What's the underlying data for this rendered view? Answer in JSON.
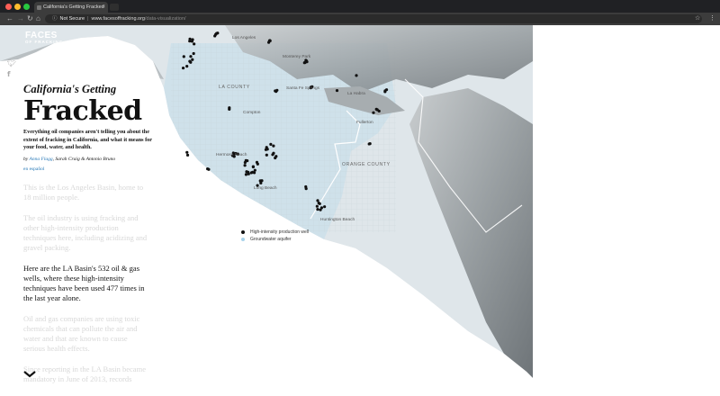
{
  "browser": {
    "tab_title": "California's Getting Fracked",
    "tab_close": "×",
    "info_icon": "info-icon",
    "not_secure": "Not Secure",
    "separator": "|",
    "url_host": "www.facesoffracking.org",
    "url_path": "/data-visualization/",
    "colors": {
      "titlebar": "#202124",
      "toolbar": "#3c3c3c"
    }
  },
  "brand": {
    "line1": "FACES",
    "line2": "OF FRACKING"
  },
  "social": {
    "twitter": "twitter-icon",
    "facebook": "facebook-icon"
  },
  "story": {
    "kicker": "California's Getting",
    "headline": "Fracked",
    "dek": "Everything oil companies aren't telling you about the extent of fracking in California, and what it means for your food, water, and health.",
    "byline_prefix": "by",
    "author1": "Anna Flagg",
    "byline_sep": ",",
    "author2_rest": "Sarah Craig & Antonio Bruno",
    "language": "en español",
    "paragraphs": [
      {
        "text": "This is the Los Angeles Basin, home to 18 million people.",
        "active": false
      },
      {
        "text": "The oil industry is using fracking and other high-intensity production techniques here, including acidizing and gravel packing.",
        "active": false
      },
      {
        "text": "Here are the LA Basin's 532 oil & gas wells, where these high-intensity techniques have been used 477 times in the last year alone.",
        "active": true
      },
      {
        "text": "Oil and gas companies are using toxic chemicals that can pollute the air and water and that are known to cause serious health effects.",
        "active": false
      },
      {
        "text": "Since reporting in the LA Basin became mandatory in June of 2013, records",
        "active": false
      }
    ]
  },
  "map": {
    "labels": {
      "los_angeles": "Los Angeles",
      "monterey_park": "Monterey Park",
      "la_county": "LA COUNTY",
      "santa_fe_springs": "Santa Fe Springs",
      "la_habra": "La Habra",
      "compton": "Compton",
      "fullerton": "Fullerton",
      "long_beach": "Long Beach",
      "orange_county": "ORANGE COUNTY",
      "huntington_beach": "Huntington Beach",
      "hermosa_beach": "Hermosa Beach"
    },
    "legend": [
      {
        "label": "High-intensity production well",
        "color": "#111111"
      },
      {
        "label": "Groundwater aquifer",
        "color": "#a9d3ea"
      }
    ]
  }
}
